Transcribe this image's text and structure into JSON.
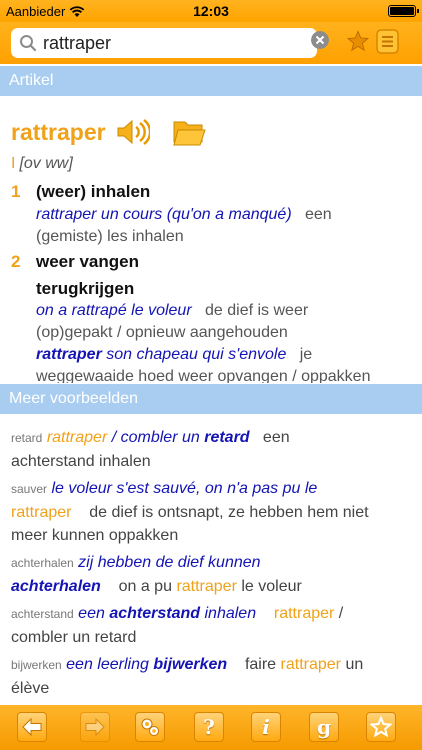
{
  "status": {
    "carrier": "Aanbieder",
    "time": "12:03"
  },
  "search": {
    "value": "rattraper"
  },
  "sections": {
    "article": "Artikel",
    "more": "Meer voorbeelden"
  },
  "article": {
    "headword": "rattraper",
    "pos_roman": "I",
    "pos": "[ov ww]",
    "senses": [
      {
        "num": "1",
        "head": "(weer) inhalen",
        "examples": [
          {
            "fr": "rattraper un cours (qu'on a manqué)",
            "nl_1": "een",
            "nl_2": "(gemiste) les inhalen"
          }
        ]
      },
      {
        "num": "2",
        "head": "weer vangen",
        "head2": "terugkrijgen",
        "examples": [
          {
            "fr": "on a rattrapé le voleur",
            "nl_1": "de dief is weer",
            "nl_2": "(op)gepakt / opnieuw aangehouden"
          },
          {
            "fr_bold": "rattraper",
            "fr": "son chapeau qui s'envole",
            "nl_1": "je",
            "nl_2": "weggewaaide hoed weer opvangen / oppakken"
          }
        ]
      }
    ]
  },
  "more_examples": [
    {
      "tag": "retard",
      "kw": "rattraper",
      "fr_pre": " / combler un ",
      "fr_bold": "retard",
      "nl_1": "een",
      "nl_2": "achterstand inhalen"
    },
    {
      "tag": "sauver",
      "fr": "le voleur s'est sauvé, on n'a pas pu le",
      "kw": "rattraper",
      "nl_1": "de dief is ontsnapt, ze hebben hem niet",
      "nl_2": "meer kunnen oppakken"
    },
    {
      "tag": "achterhalen",
      "fr": "zij hebben de dief kunnen",
      "fr_bold": "achterhalen",
      "nl_1": "on a pu",
      "kw": "rattraper",
      "nl_2": "le voleur"
    },
    {
      "tag": "achterstand",
      "fr": "een",
      "fr_bold": "achterstand",
      "fr_post": "inhalen",
      "kw": "rattraper",
      "nl_1": "/",
      "nl_2": "combler un retard"
    },
    {
      "tag": "bijwerken",
      "fr": "een leerling",
      "fr_bold": "bijwerken",
      "nl_1": "faire",
      "kw": "rattraper",
      "nl_2": "un",
      "nl_3": "élève"
    }
  ],
  "toolbar": {
    "info_glyph": "i",
    "google_glyph": "g",
    "help_glyph": "?"
  },
  "colors": {
    "orange": "#ffa400",
    "headword": "#f0a21a",
    "french": "#1414b4",
    "section": "#a9cdf0"
  }
}
